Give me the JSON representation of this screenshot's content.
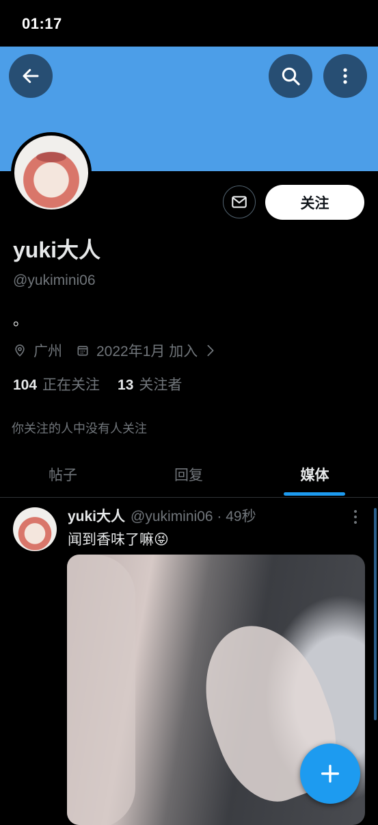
{
  "status_bar": {
    "time": "01:17"
  },
  "header": {
    "back_icon": "arrow-left-icon",
    "search_icon": "search-icon",
    "more_icon": "more-vertical-icon",
    "banner_color": "#4c9ee8"
  },
  "profile": {
    "display_name": "yuki大人",
    "handle": "@yukimini06",
    "bio": "。",
    "location": "广州",
    "joined": "2022年1月 加入",
    "following_count": "104",
    "following_label": "正在关注",
    "followers_count": "13",
    "followers_label": "关注者",
    "followed_by_note": "你关注的人中没有人关注",
    "follow_button": "关注",
    "message_icon": "envelope-icon"
  },
  "tabs": [
    {
      "label": "帖子",
      "active": false
    },
    {
      "label": "回复",
      "active": false
    },
    {
      "label": "媒体",
      "active": true
    }
  ],
  "post": {
    "name": "yuki大人",
    "meta": "@yukimini06 · 49秒",
    "text": "闻到香味了嘛😝"
  },
  "fab": {
    "icon": "plus-icon"
  },
  "colors": {
    "accent": "#1d9bf0",
    "background": "#000000",
    "secondary_text": "#71767b"
  }
}
